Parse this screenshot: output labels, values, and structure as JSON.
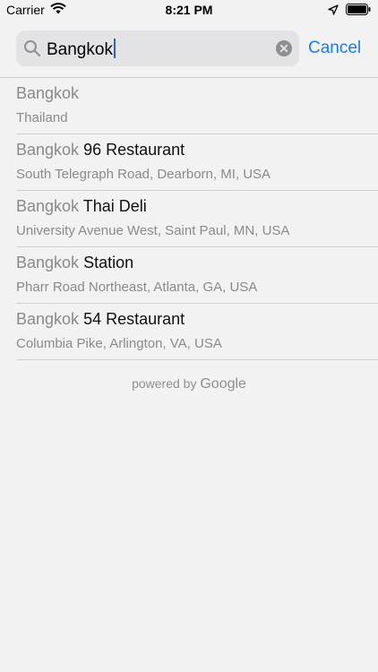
{
  "status_bar": {
    "carrier": "Carrier",
    "time": "8:21 PM",
    "icons": [
      "wifi-icon",
      "location-arrow-icon",
      "battery-icon"
    ]
  },
  "search": {
    "query": "Bangkok",
    "cancel_label": "Cancel",
    "icons": [
      "search-icon",
      "clear-icon"
    ]
  },
  "results": [
    {
      "match": "Bangkok",
      "rest": "",
      "secondary": "Thailand"
    },
    {
      "match": "Bangkok",
      "rest": " 96 Restaurant",
      "secondary": "South Telegraph Road, Dearborn, MI, USA"
    },
    {
      "match": "Bangkok",
      "rest": " Thai Deli",
      "secondary": "University Avenue West, Saint Paul, MN, USA"
    },
    {
      "match": "Bangkok",
      "rest": " Station",
      "secondary": "Pharr Road Northeast, Atlanta, GA, USA"
    },
    {
      "match": "Bangkok",
      "rest": " 54 Restaurant",
      "secondary": "Columbia Pike, Arlington, VA, USA"
    }
  ],
  "footer": {
    "powered_by": "powered by",
    "brand": "Google"
  },
  "colors": {
    "accent": "#1a7cf4",
    "background": "#f2f2f2",
    "search_field": "#e3e3e6",
    "secondary_text": "#8a8a8a"
  }
}
